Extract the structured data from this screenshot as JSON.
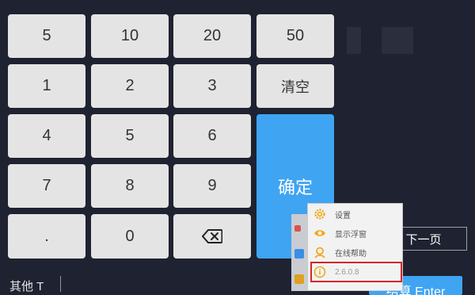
{
  "keypad": {
    "k5": "5",
    "k10": "10",
    "k20": "20",
    "k50": "50",
    "k1": "1",
    "k2": "2",
    "k3": "3",
    "clear": "清空",
    "k4": "4",
    "k5b": "5",
    "k6": "6",
    "confirm": "确定",
    "k7": "7",
    "k8": "8",
    "k9": "9",
    "dot": ".",
    "k0": "0"
  },
  "next_page": "下一页",
  "checkout": "结算 Enter",
  "other_label": "其他 T",
  "context_menu": {
    "settings": "设置",
    "show_float": "显示浮窗",
    "help": "在线帮助",
    "version": "2.6.0.8"
  },
  "colors": {
    "background": "#1f2230",
    "key": "#e4e4e4",
    "accent": "#3fa4f2",
    "highlight": "#d4272a",
    "menu_icon": "#f0a81c"
  }
}
